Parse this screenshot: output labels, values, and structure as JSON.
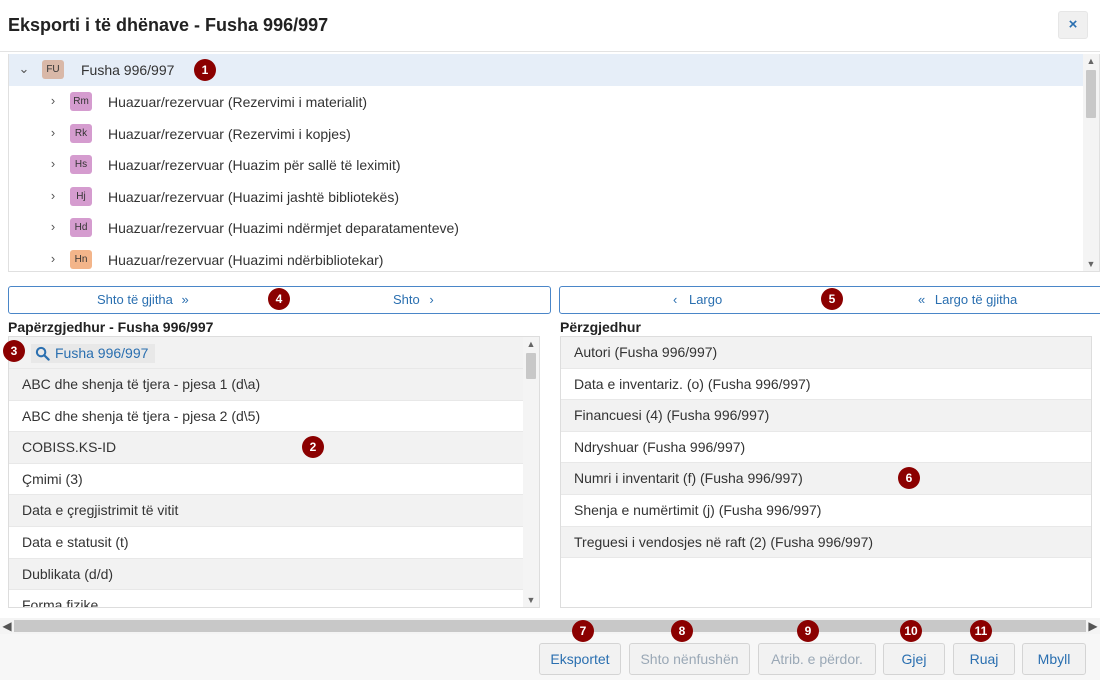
{
  "dialog": {
    "title": "Eksporti i të dhënave - Fusha 996/997",
    "close_glyph": "×"
  },
  "tree": {
    "root": {
      "badge": "FU",
      "label": "Fusha 996/997",
      "badge_color": "#d9b8a8"
    },
    "children": [
      {
        "badge": "Rm",
        "label": "Huazuar/rezervuar (Rezervimi i materialit)",
        "badge_color": "#d59ccf"
      },
      {
        "badge": "Rk",
        "label": "Huazuar/rezervuar (Rezervimi i kopjes)",
        "badge_color": "#d59ccf"
      },
      {
        "badge": "Hs",
        "label": "Huazuar/rezervuar (Huazim për sallë të leximit)",
        "badge_color": "#d59ccf"
      },
      {
        "badge": "Hj",
        "label": "Huazuar/rezervuar (Huazimi jashtë bibliotekës)",
        "badge_color": "#d59ccf"
      },
      {
        "badge": "Hd",
        "label": "Huazuar/rezervuar (Huazimi ndërmjet deparatamenteve)",
        "badge_color": "#d59ccf"
      },
      {
        "badge": "Hn",
        "label": "Huazuar/rezervuar (Huazimi ndërbibliotekar)",
        "badge_color": "#f3b58a"
      }
    ]
  },
  "left_buttons": {
    "add_all": "Shto të gjitha",
    "add": "Shto",
    "add_all_glyph": "»",
    "add_glyph": "›"
  },
  "right_buttons": {
    "remove": "Largo",
    "remove_all": "Largo të gjitha",
    "remove_glyph": "‹",
    "remove_all_glyph": "«"
  },
  "unselected": {
    "title": "Papërzgjedhur - Fusha 996/997",
    "search_value": "Fusha 996/997",
    "items": [
      "ABC dhe shenja të tjera - pjesa 1 (d\\a)",
      "ABC dhe shenja të tjera - pjesa 2 (d\\5)",
      "COBISS.KS-ID",
      "Çmimi (3)",
      "Data e çregjistrimit të vitit",
      "Data e statusit (t)",
      "Dublikata (d/d)",
      "Forma fizike"
    ]
  },
  "selected": {
    "title": "Përzgjedhur",
    "items": [
      "Autori (Fusha 996/997)",
      "Data e inventariz. (o) (Fusha 996/997)",
      "Financuesi (4) (Fusha 996/997)",
      "Ndryshuar (Fusha 996/997)",
      "Numri i inventarit (f) (Fusha 996/997)",
      "Shenja e numërtimit (j) (Fusha 996/997)",
      "Treguesi i vendosjes në raft (2) (Fusha 996/997)"
    ]
  },
  "footer": {
    "exports": "Eksportet",
    "add_subfields": "Shto nënfushën",
    "used_attrs": "Atrib. e përdor.",
    "find": "Gjej",
    "save": "Ruaj",
    "close": "Mbyll"
  },
  "markers": [
    "1",
    "2",
    "3",
    "4",
    "5",
    "6",
    "7",
    "8",
    "9",
    "10",
    "11"
  ],
  "colors": {
    "accent": "#2a6fb0",
    "marker": "#8b0000",
    "selected_row": "#e6eef8"
  }
}
